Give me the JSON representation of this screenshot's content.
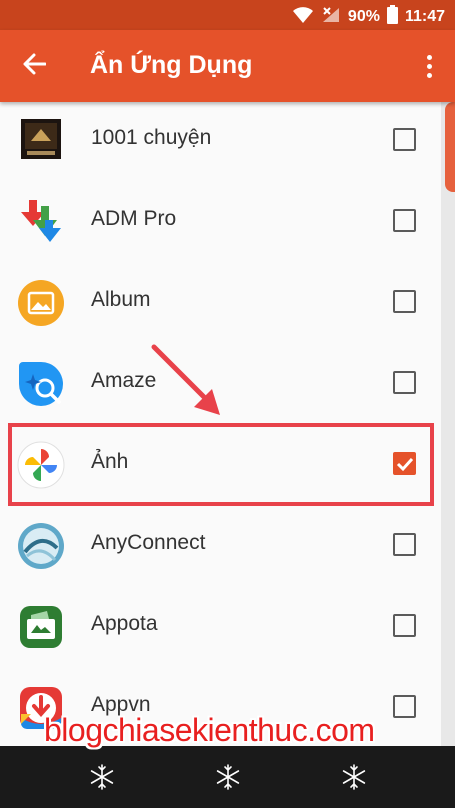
{
  "status_bar": {
    "battery": "90%",
    "time": "11:47",
    "icons": [
      "wifi-icon",
      "signal-x-icon",
      "battery-icon"
    ]
  },
  "app_bar": {
    "title": "Ẩn Ứng Dụng",
    "back_icon": "arrow-left-icon",
    "menu_icon": "more-vert-icon"
  },
  "apps": [
    {
      "label": "1001 chuyện",
      "checked": false,
      "icon": "book-thumbnail-icon"
    },
    {
      "label": "ADM Pro",
      "checked": false,
      "icon": "download-arrows-icon"
    },
    {
      "label": "Album",
      "checked": false,
      "icon": "album-photo-icon"
    },
    {
      "label": "Amaze",
      "checked": false,
      "icon": "amaze-magnifier-icon"
    },
    {
      "label": "Ảnh",
      "checked": true,
      "icon": "google-photos-pinwheel-icon"
    },
    {
      "label": "AnyConnect",
      "checked": false,
      "icon": "anyconnect-globe-icon"
    },
    {
      "label": "Appota",
      "checked": false,
      "icon": "appota-wallet-icon"
    },
    {
      "label": "Appvn",
      "checked": false,
      "icon": "appvn-download-icon"
    }
  ],
  "watermark": "blogchiasekienthuc.com",
  "nav_bar": {
    "icons": [
      "snowflake-icon",
      "snowflake-icon",
      "snowflake-icon"
    ]
  },
  "colors": {
    "status_bar": "#c8441d",
    "app_bar": "#e5522a",
    "accent": "#e5522a",
    "highlight": "#e8424a"
  }
}
